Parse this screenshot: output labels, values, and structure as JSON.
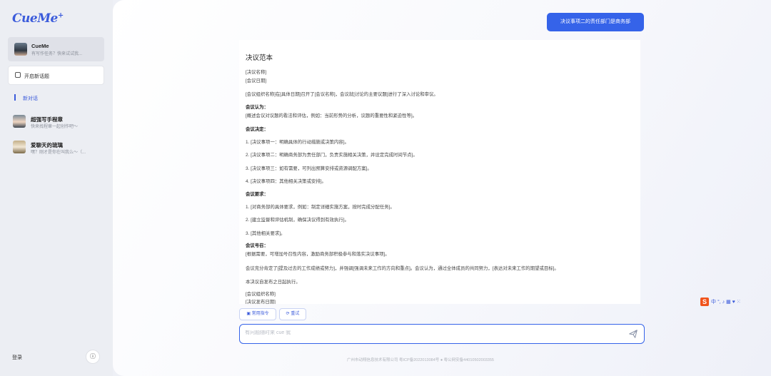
{
  "app": {
    "logo": "CueMe",
    "logo_mark": "+"
  },
  "sidebar": {
    "active": {
      "name": "CueMe",
      "sub": "有写作任务？快来试试我..."
    },
    "new_topic_label": "开启新话题",
    "new_chat_label": "新对话",
    "items": [
      {
        "name": "超强写手程章",
        "sub": "快来找程章一起创作吧～"
      },
      {
        "name": "爱聊天的琉璃",
        "sub": "嘿？刚才是你在叫我么～（..."
      }
    ],
    "login_label": "登录",
    "info_icon": "ⓘ"
  },
  "chat": {
    "user_message": "决议事项二的责任部门是商务部",
    "answer": {
      "title": "决议范本",
      "lines": [
        {
          "text": "[决议名称]",
          "bold": false
        },
        {
          "text": "[会议日期]",
          "bold": false
        },
        {
          "text": "[会议组织名称]在[具体日期]召开了[会议名称]，会议就[讨论的主要议题]进行了深入讨论和审议。",
          "bold": false
        },
        {
          "text": "会议认为：",
          "bold": true
        },
        {
          "text": "[概述会议对议题的看法和评估，例如：当前形势的分析，议题的重要性和紧迫性等]。",
          "bold": false
        },
        {
          "text": "会议决定：",
          "bold": true
        },
        {
          "text": "1. [决议事项一：明确具体的行动措施或决策内容]。",
          "bold": false
        },
        {
          "text": "2. [决议事项二：明确商务部为责任部门，负责实施相关决策，并设定完成时间节点]。",
          "bold": false
        },
        {
          "text": "3. [决议事项三：如有需要，可列出预算安排或资源调配方案]。",
          "bold": false
        },
        {
          "text": "4. [决议事项四：其他相关决策或安排]。",
          "bold": false
        },
        {
          "text": "会议要求：",
          "bold": true
        },
        {
          "text": "1. [对商务部的具体要求，例如：制定详细实施方案，按时完成分配任务]。",
          "bold": false
        },
        {
          "text": "2. [建立监督和评估机制，确保决议得到有效执行]。",
          "bold": false
        },
        {
          "text": "3. [其他相关要求]。",
          "bold": false
        },
        {
          "text": "会议号召：",
          "bold": true
        },
        {
          "text": "[根据需要，可增加号召性内容，激励商务部积极参与和落实决议事项]。",
          "bold": false
        },
        {
          "text": "会议充分肯定了[提及过去的工作成绩或努力]，并强调[强调未来工作的方向和重点]。会议认为，通过全体成员的共同努力，[表达对未来工作的期望或目标]。",
          "bold": false
        },
        {
          "text": "本决议自发布之日起执行。",
          "bold": false
        },
        {
          "text": "[会议组织名称]",
          "bold": false
        },
        {
          "text": "[决议发布日期]",
          "bold": false
        }
      ]
    },
    "chips": {
      "commands": "常用指令",
      "retry": "重试"
    },
    "input_placeholder": "有问题随时来 cue 我",
    "send_icon": "send-icon"
  },
  "footer": "广州市动翔信息技术有限公司 粤ICP备2022013084号  ●  粤公网安备44010502003355",
  "ime_bar": {
    "logo": "S",
    "items": "中 °, ♪ ▦ ♥ ⁙"
  },
  "colors": {
    "accent": "#3563e9",
    "sidebar_bg": "#eceef3"
  }
}
